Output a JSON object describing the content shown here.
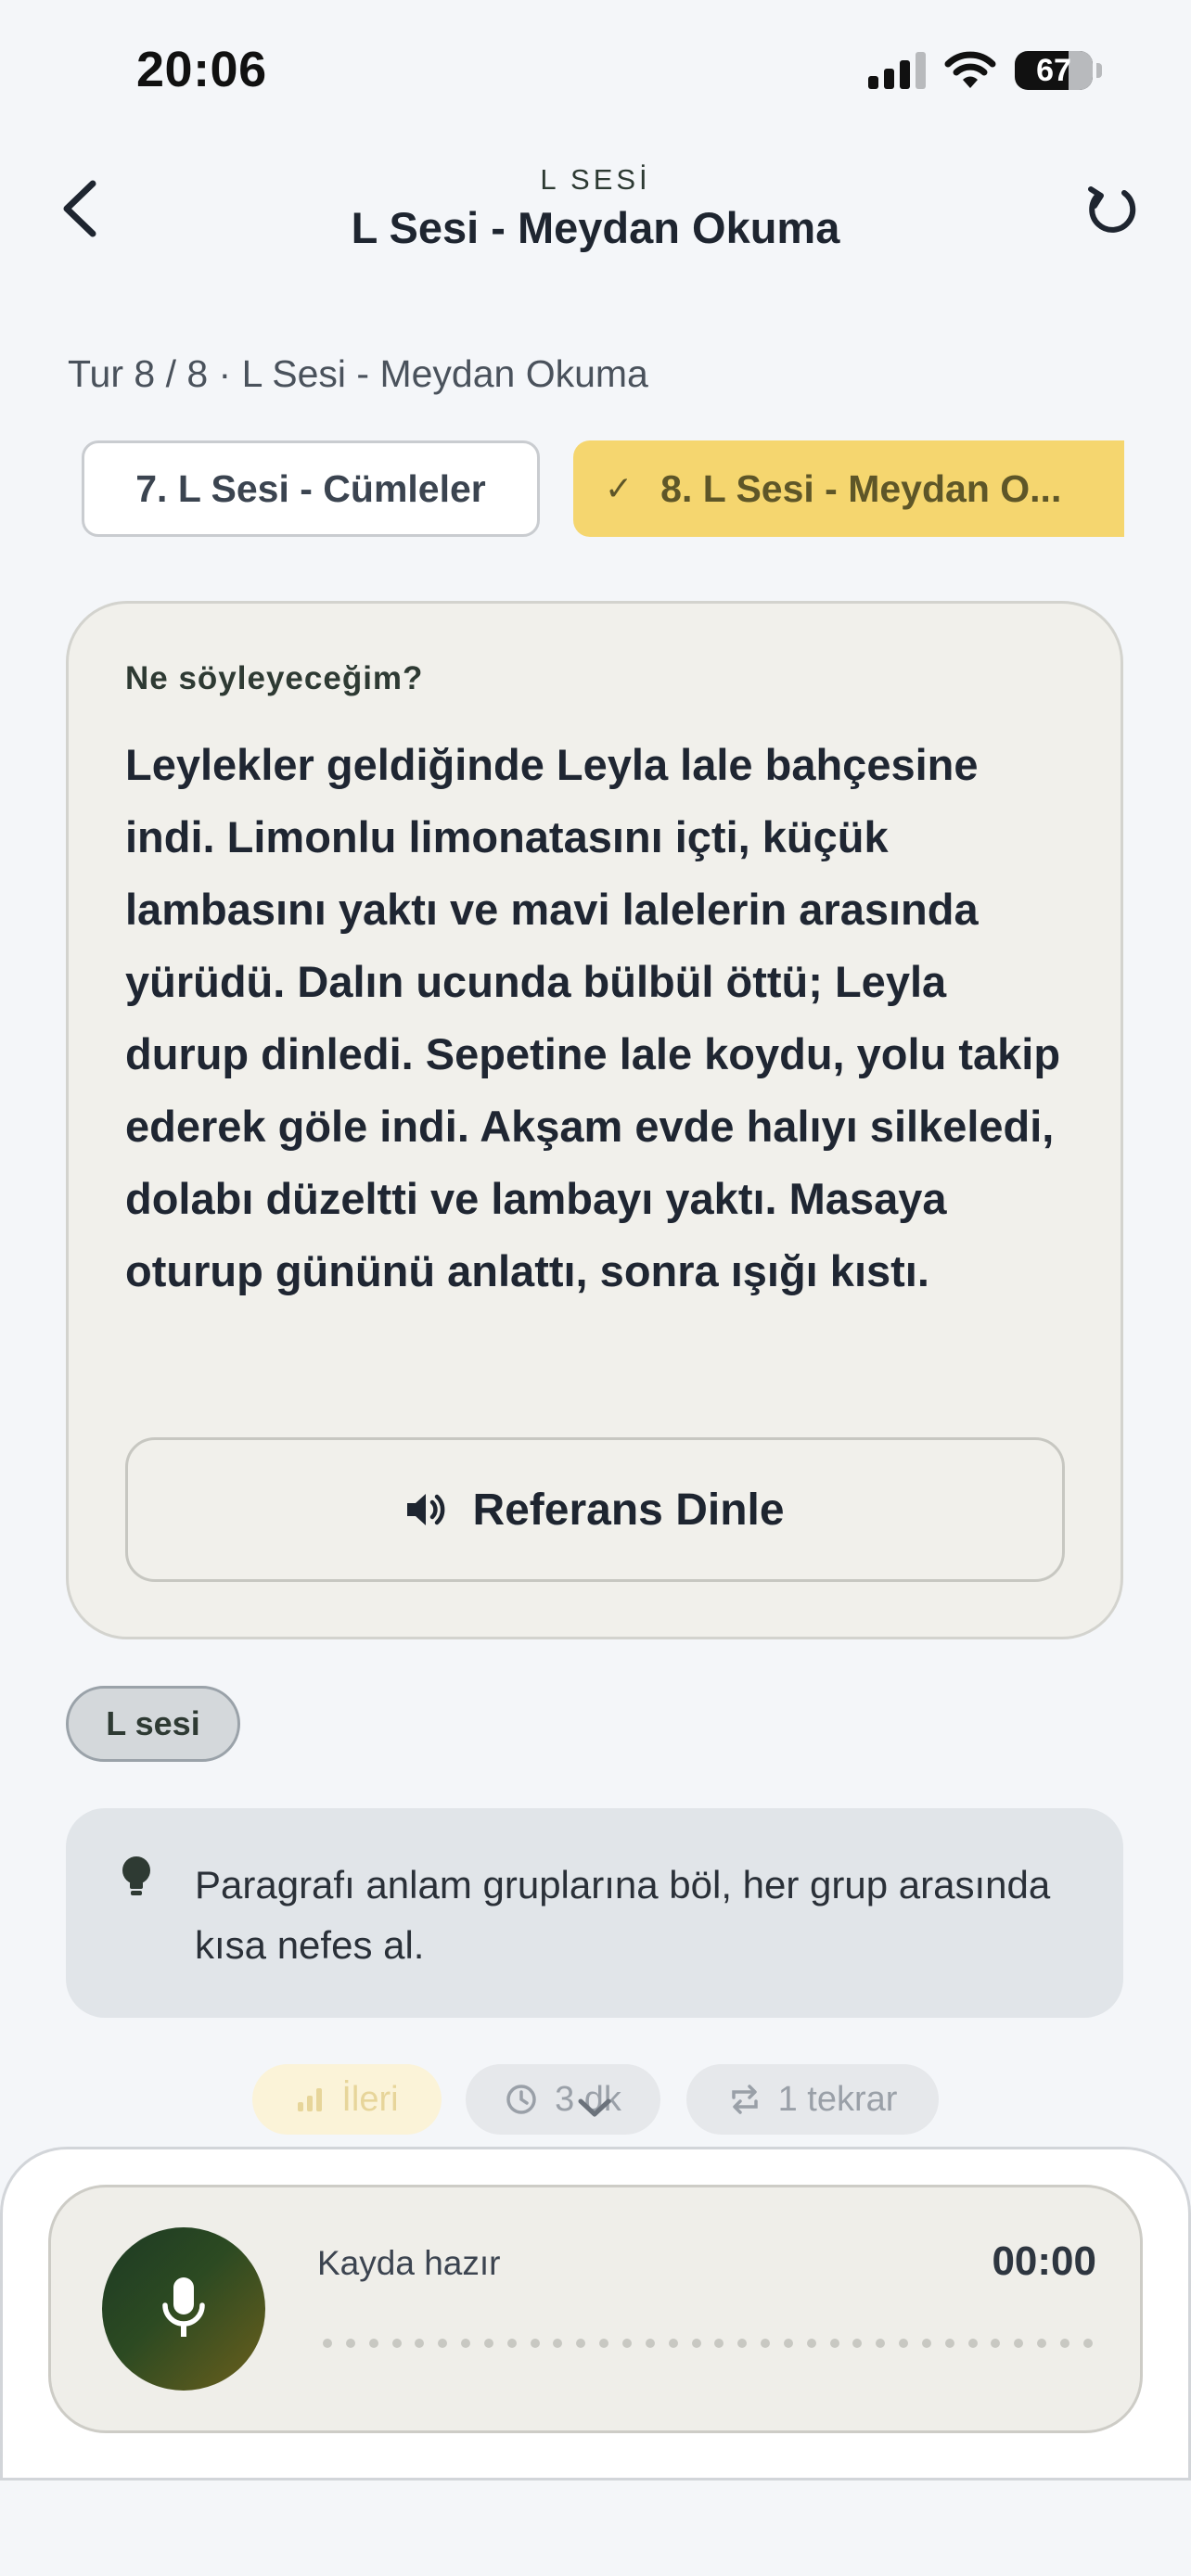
{
  "status_bar": {
    "time": "20:06",
    "battery": "67",
    "icons": [
      "signal-icon",
      "wifi-icon",
      "battery-icon"
    ]
  },
  "header": {
    "kicker": "L SESİ",
    "title": "L Sesi - Meydan Okuma",
    "icons": [
      "chevron-left-icon",
      "reload-icon"
    ]
  },
  "round_label": "Tur 8 / 8 · L Sesi - Meydan Okuma",
  "exercise_tabs": [
    {
      "label": "7. L Sesi - Cümleler",
      "selected": false
    },
    {
      "label": "8. L Sesi - Meydan O...",
      "selected": true
    }
  ],
  "card": {
    "label": "Ne söyleyeceğim?",
    "text": "Leylekler geldiğinde Leyla lale bahçesine indi. Limonlu limonatasını içti, küçük lambasını yaktı ve mavi lalelerin arasında yürüdü. Dalın ucunda bülbül öttü; Leyla durup dinledi. Sepetine lale koydu, yolu takip ederek göle indi. Akşam evde halıyı silkeledi, dolabı düzeltti ve lambayı yaktı. Masaya oturup gününü anlattı, sonra ışığı kıstı.",
    "listen_button": "Referans Dinle"
  },
  "tag": "L sesi",
  "tip": {
    "text": "Paragrafı anlam gruplarına böl, her grup arasında kısa nefes al."
  },
  "chips": {
    "level": "İleri",
    "duration": "3 dk",
    "repeat": "1 tekrar"
  },
  "recorder": {
    "status": "Kayda hazır",
    "timer": "00:00"
  },
  "colors": {
    "accent_yellow": "#f5d66f",
    "mic_green": "#1d3a24",
    "card_bg": "#f1f0eb",
    "tip_bg": "#e1e5e9"
  }
}
